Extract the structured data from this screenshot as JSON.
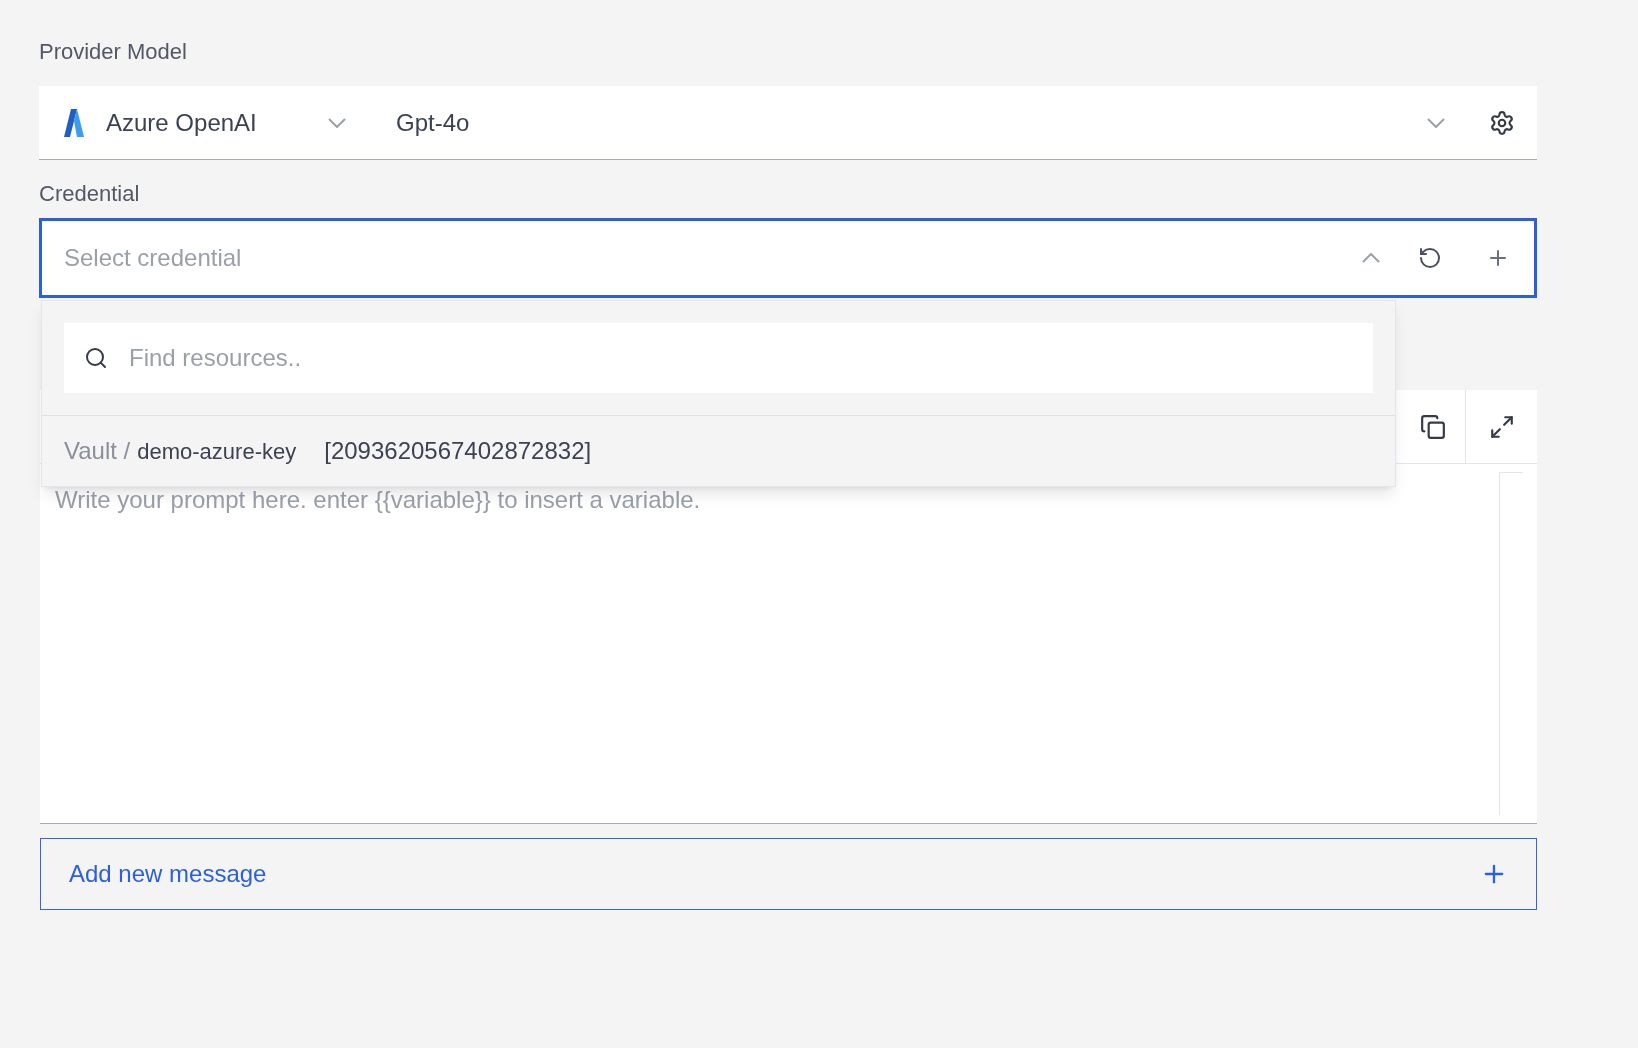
{
  "provider_model": {
    "label": "Provider Model",
    "provider": "Azure OpenAI",
    "model": "Gpt-4o"
  },
  "credential": {
    "label": "Credential",
    "placeholder": "Select credential",
    "expanded": true,
    "dropdown": {
      "search_placeholder": "Find resources..",
      "items": [
        {
          "path": "Vault /",
          "name": "demo-azure-key",
          "id": "[2093620567402872832]",
          "selected": false
        }
      ]
    }
  },
  "editor": {
    "placeholder": "Write your prompt here. enter {{variable}} to insert a variable."
  },
  "add_button": {
    "label": "Add new message"
  }
}
